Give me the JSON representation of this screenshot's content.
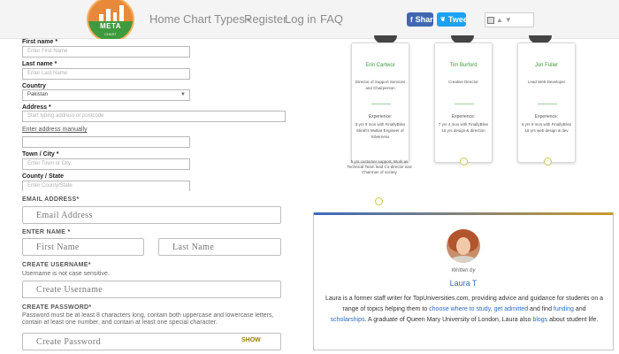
{
  "nav": {
    "logo_text": "META",
    "logo_sub": "CHART",
    "items": [
      {
        "label": "Home"
      },
      {
        "label": "Chart Types"
      },
      {
        "label": "Register"
      },
      {
        "label": "Log in"
      },
      {
        "label": "FAQ"
      }
    ],
    "share_label": "Share",
    "tweet_label": "Tweet"
  },
  "form_top": {
    "first_name_label": "First name *",
    "first_name_placeholder": "Enter First Name",
    "last_name_label": "Last name *",
    "last_name_placeholder": "Enter Last Name",
    "country_label": "Country",
    "country_value": "Pakistan",
    "address_label": "Address *",
    "address_placeholder": "Start typing address or postcode",
    "manual_link": "Enter address manually",
    "town_label": "Town / City *",
    "town_placeholder": "Enter Town or City",
    "county_label": "County / State",
    "county_placeholder": "Enter County/State"
  },
  "form_bottom": {
    "email_label": "EMAIL ADDRESS",
    "email_placeholder": "Email Address",
    "name_label": "ENTER NAME",
    "first_placeholder": "First Name",
    "last_placeholder": "Last Name",
    "username_label": "CREATE USERNAME",
    "username_hint": "Username is not case sensitive.",
    "username_placeholder": "Create Username",
    "password_label": "CREATE PASSWORD",
    "password_hint": "Password must be at least 8 characters long, contain both uppercase and lowercase letters, contain at least one number, and contain at least one special character.",
    "password_placeholder": "Create Password",
    "show_label": "SHOW"
  },
  "team": [
    {
      "name": "Erin Cartwor",
      "role": "Director of Support Services and Chairperson",
      "exp_label": "Experience:",
      "experience": "8 yrs 9 mos with FinallyBliss Mirah's Multiar Engineer of Silverness"
    },
    {
      "name": "Tim Burford",
      "role": "Creative Director",
      "exp_label": "Experience:",
      "experience": "7 yrs 4 mos with FinallyBliss 15 yrs design & direction"
    },
    {
      "name": "Jon Fuller",
      "role": "Lead Web Developer",
      "exp_label": "Experience:",
      "experience": "6 yrs 9 mos with FinallyBliss 18 yrs web design & dev"
    }
  ],
  "team_note": "5 yrs customer support, Work as Technical Team lead Co-director and Chairman of society",
  "author": {
    "written_by": "Written by",
    "name": "Laura T",
    "bio_1": "Laura is a former staff writer for TopUniversities.com, providing advice and guidance for students on a range of topics helping them to ",
    "link_1": "choose where to study",
    "bio_2": ", ",
    "link_2": "get admitted",
    "bio_3": " and find ",
    "link_3": "funding",
    "bio_4": " and ",
    "link_4": "scholarships",
    "bio_5": ". A graduate of Queen Mary University of London, Laura also ",
    "link_5": "blogs",
    "bio_6": " about student life."
  },
  "colors": {
    "accent_green": "#3a9a3a",
    "link_blue": "#2b6cbf",
    "facebook": "#4267b2",
    "twitter": "#1da1f2"
  }
}
